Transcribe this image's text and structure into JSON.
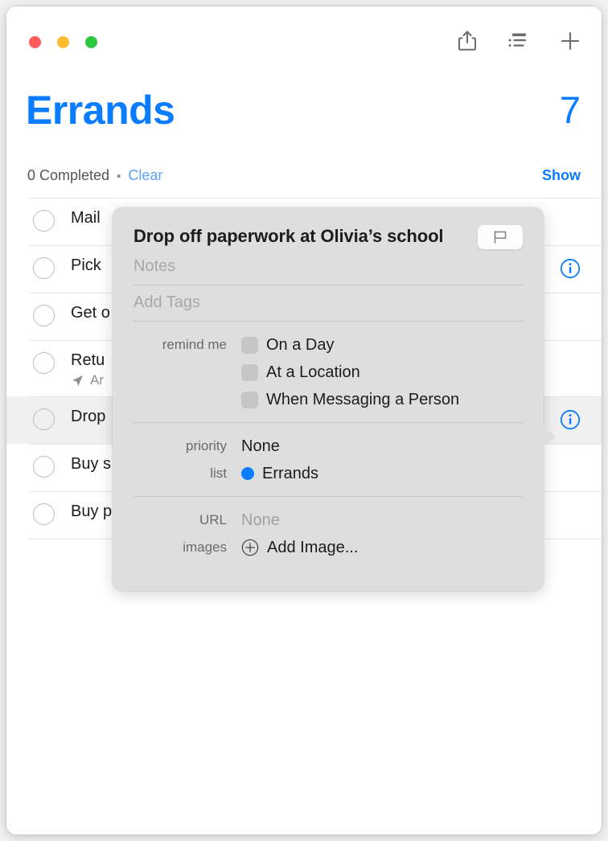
{
  "window": {
    "traffic_lights": [
      {
        "name": "close",
        "color": "#fc5b57"
      },
      {
        "name": "minimize",
        "color": "#fdbc2e"
      },
      {
        "name": "zoom",
        "color": "#2bc840"
      }
    ]
  },
  "toolbar": {
    "share_icon": "share-icon",
    "sort_icon": "list-sort-icon",
    "add_icon": "plus-icon"
  },
  "header": {
    "title": "Errands",
    "count": "7",
    "completed_text": "0 Completed",
    "separator": "•",
    "clear_label": "Clear",
    "show_label": "Show",
    "accent_color": "#0a7cff"
  },
  "reminders": [
    {
      "title": "Mail ",
      "subtitle": "",
      "selected": false,
      "info": false
    },
    {
      "title": "Pick ",
      "subtitle": "",
      "selected": false,
      "info": true
    },
    {
      "title": "Get o",
      "subtitle": "",
      "selected": false,
      "info": false
    },
    {
      "title": "Retu",
      "subtitle": "Ar",
      "subtitle_icon": "location-arrow-icon",
      "selected": false,
      "info": false
    },
    {
      "title": "Drop",
      "subtitle": "",
      "selected": true,
      "info": true
    },
    {
      "title": "Buy s",
      "subtitle": "",
      "selected": false,
      "info": false
    },
    {
      "title": "Buy p",
      "subtitle": "",
      "selected": false,
      "info": false
    }
  ],
  "popover": {
    "title": "Drop off paperwork at Olivia’s school",
    "flag_icon": "flag-icon",
    "notes_placeholder": "Notes",
    "tags_placeholder": "Add Tags",
    "remind_me_label": "remind me",
    "remind_options": [
      {
        "label": "On a Day",
        "checked": false
      },
      {
        "label": "At a Location",
        "checked": false
      },
      {
        "label": "When Messaging a Person",
        "checked": false
      }
    ],
    "priority_label": "priority",
    "priority_value": "None",
    "list_label": "list",
    "list_value": "Errands",
    "list_color": "#0a7cff",
    "url_label": "URL",
    "url_value": "None",
    "images_label": "images",
    "add_image_label": "Add Image...",
    "add_image_icon": "plus-circle-icon"
  }
}
